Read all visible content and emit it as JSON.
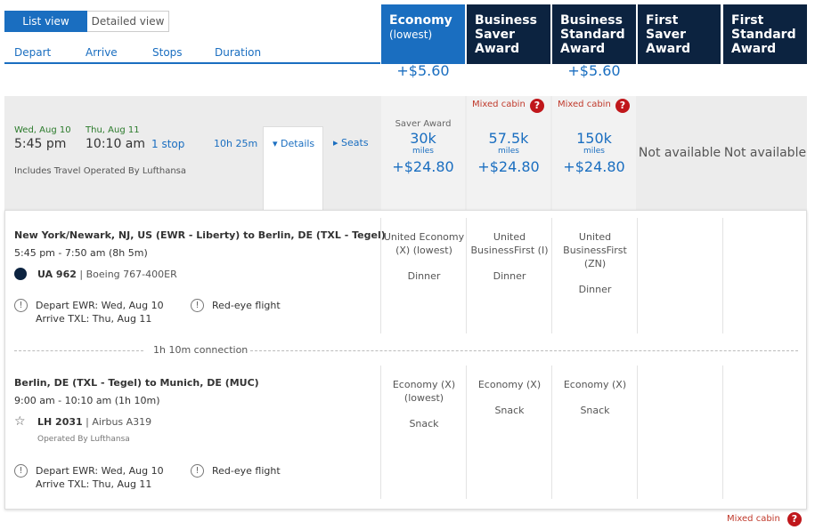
{
  "view_toggle": {
    "list": "List view",
    "detailed": "Detailed view"
  },
  "sort": {
    "depart": "Depart",
    "arrive": "Arrive",
    "stops": "Stops",
    "duration": "Duration"
  },
  "columns": [
    {
      "title": "Economy",
      "sub": "(lowest)"
    },
    {
      "title": "Business Saver Award"
    },
    {
      "title": "Business Standard Award"
    },
    {
      "title": "First Saver Award"
    },
    {
      "title": "First Standard Award"
    }
  ],
  "prev_prices": [
    "+$5.60",
    "+$5.60"
  ],
  "flight": {
    "depart_date": "Wed, Aug 10",
    "depart_time": "5:45 pm",
    "arrive_date": "Thu, Aug 11",
    "arrive_time": "10:10 am",
    "stops": "1 stop",
    "duration": "10h 25m",
    "details_label": "Details",
    "seats_label": "Seats",
    "operated": "Includes Travel Operated By Lufthansa"
  },
  "fares": [
    {
      "label": "Saver Award",
      "miles": "30k",
      "unit": "miles",
      "tax": "+$24.80"
    },
    {
      "mixed": "Mixed cabin",
      "miles": "57.5k",
      "unit": "miles",
      "tax": "+$24.80"
    },
    {
      "mixed": "Mixed cabin",
      "miles": "150k",
      "unit": "miles",
      "tax": "+$24.80"
    },
    {
      "na": "Not available"
    },
    {
      "na": "Not available"
    }
  ],
  "segments": [
    {
      "route": "New York/Newark, NJ, US (EWR - Liberty) to Berlin, DE (TXL - Tegel)",
      "times": "5:45 pm - 7:50 am (8h 5m)",
      "flight_no": "UA 962",
      "aircraft": "| Boeing 767-400ER",
      "depart": "Depart EWR: Wed, Aug 10",
      "arrive": "Arrive TXL: Thu, Aug 11",
      "note": "Red-eye flight",
      "cabins": [
        {
          "c": "United Economy (X) (lowest)",
          "meal": "Dinner"
        },
        {
          "c": "United BusinessFirst (I)",
          "meal": "Dinner"
        },
        {
          "c": "United BusinessFirst (ZN)",
          "meal": "Dinner"
        }
      ]
    },
    {
      "route": "Berlin, DE (TXL - Tegel) to Munich, DE (MUC)",
      "times": "9:00 am - 10:10 am (1h 10m)",
      "flight_no": "LH 2031",
      "aircraft": "| Airbus A319",
      "operated": "Operated By Lufthansa",
      "depart": "Depart EWR: Wed, Aug 10",
      "arrive": "Arrive TXL: Thu, Aug 11",
      "note": "Red-eye flight",
      "cabins": [
        {
          "c": "Economy (X) (lowest)",
          "meal": "Snack"
        },
        {
          "c": "Economy (X)",
          "meal": "Snack"
        },
        {
          "c": "Economy (X)",
          "meal": "Snack"
        }
      ]
    }
  ],
  "connection": "1h 10m connection",
  "footer": {
    "mixed": "Mixed cabin"
  },
  "colors": {
    "accent": "#1a6ec0",
    "header_dark": "#0c2340",
    "header_active": "#1a6ec0",
    "alert": "#c0171b"
  }
}
